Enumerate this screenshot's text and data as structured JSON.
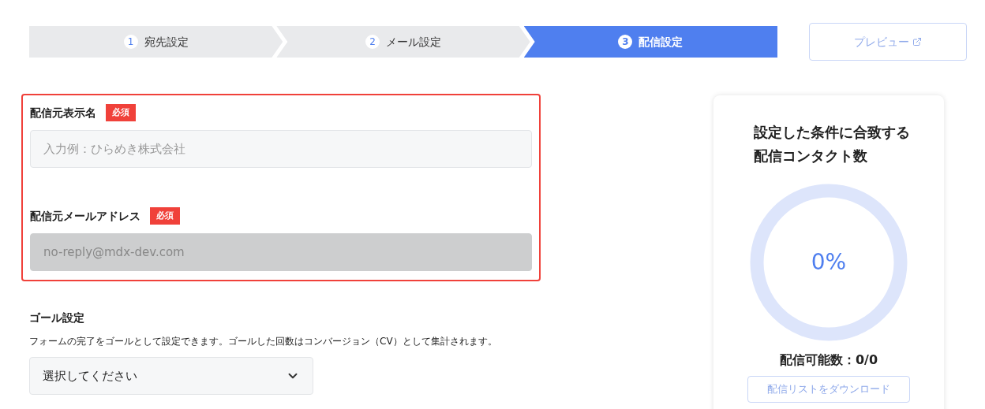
{
  "steps": [
    {
      "number": "1",
      "label": "宛先設定",
      "selected": false
    },
    {
      "number": "2",
      "label": "メール設定",
      "selected": false
    },
    {
      "number": "3",
      "label": "配信設定",
      "selected": true
    }
  ],
  "preview_button": {
    "label": "プレビュー",
    "disabled": true
  },
  "sender_fields": [
    {
      "label": "配信元表示名",
      "badge": "必須",
      "placeholder": "入力例：ひらめき株式会社",
      "disabled": false
    },
    {
      "label": "配信元メールアドレス",
      "badge": "必須",
      "value": "no-reply@mdx-dev.com",
      "disabled": true
    }
  ],
  "goal": {
    "title": "ゴール設定",
    "description": "フォームの完了をゴールとして設定できます。ゴールした回数はコンバージョン（CV）として集計されます。",
    "select_placeholder": "選択してください"
  },
  "summary": {
    "title_lines": [
      "設定した条件に合致する",
      "配信コンタクト数"
    ],
    "level": 0,
    "percent": "0%",
    "count": "配信可能数：0/0",
    "download_button": "配信リストをダウンロード"
  }
}
